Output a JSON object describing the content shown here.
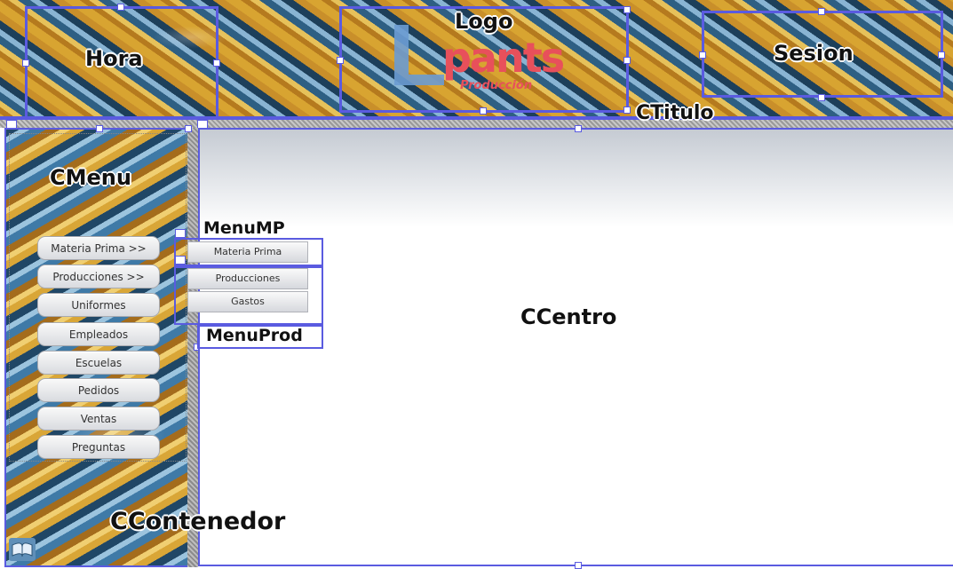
{
  "header": {
    "hora_label": "Hora",
    "logo_label": "Logo",
    "logo_text": "pants",
    "logo_subtitle": "Producción",
    "sesion_label": "Sesion",
    "titulo_label": "CTitulo"
  },
  "sidebar": {
    "title": "CMenu",
    "items": [
      {
        "label": "Materia Prima >>"
      },
      {
        "label": "Producciones >>"
      },
      {
        "label": "Uniformes"
      },
      {
        "label": "Empleados"
      },
      {
        "label": "Escuelas"
      },
      {
        "label": "Pedidos"
      },
      {
        "label": "Ventas"
      },
      {
        "label": "Preguntas"
      }
    ]
  },
  "submenus": {
    "menu_mp_label": "MenuMP",
    "menu_mp_items": [
      "Materia Prima"
    ],
    "menu_prod_label": "MenuProd",
    "menu_prod_items": [
      "Producciones",
      "Gastos"
    ]
  },
  "main": {
    "center_label": "CCentro",
    "container_label": "CContenedor"
  },
  "colors": {
    "selection": "#5a5be0",
    "logo_red": "#e8505b",
    "logo_blue": "#6b9bd1"
  },
  "icons": {
    "book": "book-icon"
  }
}
